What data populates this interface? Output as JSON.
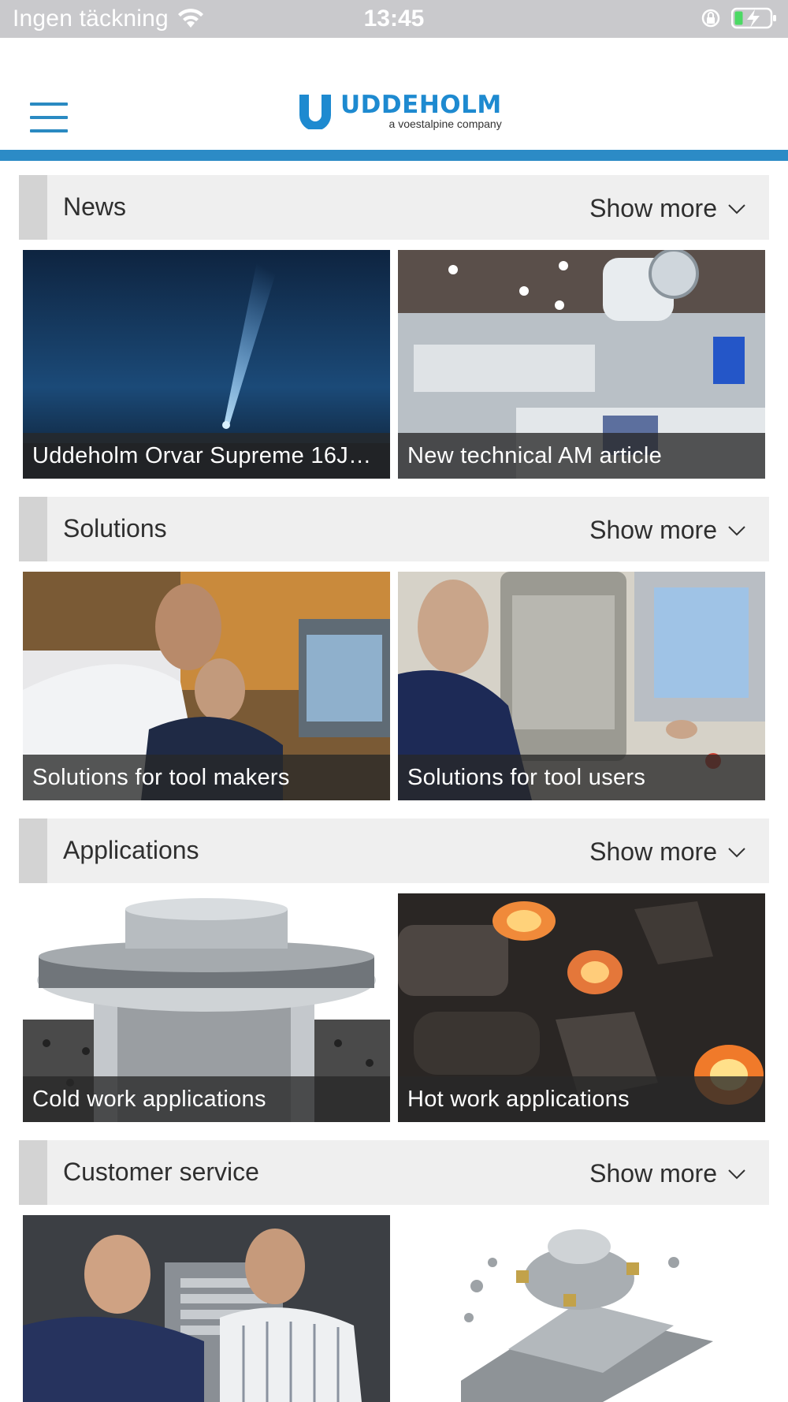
{
  "status_bar": {
    "carrier": "Ingen täckning",
    "time": "13:45",
    "icons": [
      "wifi-icon",
      "orientation-lock-icon",
      "battery-charging-icon"
    ]
  },
  "header": {
    "brand_name": "UDDEHOLM",
    "brand_tagline": "a voestalpine company",
    "menu_icon": "hamburger-menu-icon",
    "accent_color": "#2c8bc6"
  },
  "sections": [
    {
      "title": "News",
      "show_more": "Show more",
      "cards": [
        {
          "caption": "Uddeholm Orvar Supreme 16J…",
          "image": "night-sky-beam-photo"
        },
        {
          "caption": "New technical AM article",
          "image": "industrial-machinery-photo"
        }
      ]
    },
    {
      "title": "Solutions",
      "show_more": "Show more",
      "cards": [
        {
          "caption": "Solutions for tool makers",
          "image": "engineers-at-screen-photo"
        },
        {
          "caption": "Solutions for tool users",
          "image": "operator-at-machine-photo"
        }
      ]
    },
    {
      "title": "Applications",
      "show_more": "Show more",
      "cards": [
        {
          "caption": "Cold work applications",
          "image": "steel-die-photo"
        },
        {
          "caption": "Hot work applications",
          "image": "hot-forging-photo"
        }
      ]
    },
    {
      "title": "Customer service",
      "show_more": "Show more",
      "cards": [
        {
          "caption": "",
          "image": "two-men-discussing-photo"
        },
        {
          "caption": "",
          "image": "milled-steel-block-photo"
        }
      ]
    }
  ]
}
